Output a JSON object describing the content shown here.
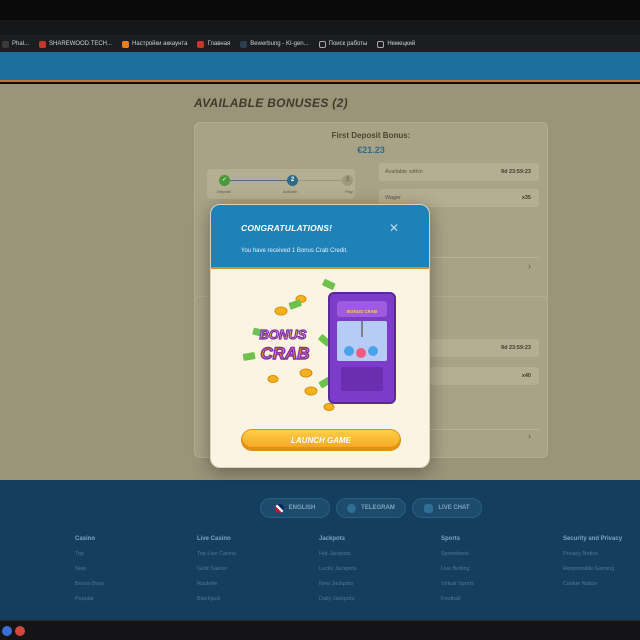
{
  "bookmarks": [
    {
      "label": "Phal...",
      "color": "#3a3a3a"
    },
    {
      "label": "SHAREWOOD.TECH...",
      "color": "#c0392b"
    },
    {
      "label": "Настройки аккаунта",
      "color": "#e67e22"
    },
    {
      "label": "Главная",
      "color": "#c0392b"
    },
    {
      "label": "Bewerbung - KI-gen...",
      "color": "#2c3e50"
    },
    {
      "label": "Поиск работы",
      "color": "#555555"
    },
    {
      "label": "Немецкий",
      "color": "#555555"
    }
  ],
  "page": {
    "title": "AVAILABLE BONUSES (2)",
    "card1": {
      "title": "First Deposit Bonus:",
      "amount": "€21.23",
      "steps": [
        "Deposit",
        "Activate",
        "Play"
      ],
      "step3_num": "3",
      "rows": [
        {
          "key": "Available within",
          "value": "9d 23:59:23"
        },
        {
          "key": "Wager",
          "value": "x35"
        }
      ]
    },
    "card2": {
      "rows": [
        {
          "key": "",
          "value": "9d 23:59:23"
        },
        {
          "key": "",
          "value": "x40"
        }
      ]
    },
    "chevron": "›"
  },
  "modal": {
    "title": "CONGRATULATIONS!",
    "message": "You have received 1 Bonus Crab Credit.",
    "close_glyph": "✕",
    "logo_line1": "BONUS",
    "logo_line2": "CRAB",
    "machine_label": "BONUS CRAB",
    "launch_label": "LAUNCH GAME"
  },
  "footer": {
    "pills": [
      {
        "label": "ENGLISH",
        "icon": "uk-flag-icon"
      },
      {
        "label": "TELEGRAM",
        "icon": "telegram-icon"
      },
      {
        "label": "LIVE CHAT",
        "icon": "chat-icon"
      }
    ],
    "columns": [
      {
        "heading": "Casino",
        "links": [
          "Top",
          "New",
          "Bonus Buys",
          "Popular"
        ]
      },
      {
        "heading": "Live Casino",
        "links": [
          "Top Live Casino",
          "Gold Saloon",
          "Roulette",
          "Blackjack"
        ]
      },
      {
        "heading": "Jackpots",
        "links": [
          "Hot Jackpots",
          "Lucky Jackpots",
          "New Jackpots",
          "Daily Jackpots"
        ]
      },
      {
        "heading": "Sports",
        "links": [
          "Sportsbook",
          "Live Betting",
          "Virtual Sports",
          "Football"
        ]
      },
      {
        "heading": "Security and Privacy",
        "links": [
          "Privacy Notice",
          "Responsible Gaming",
          "Cookie Notice"
        ]
      }
    ]
  },
  "colors": {
    "header_blue": "#1d6f9e",
    "modal_blue": "#1e82b8",
    "launch_orange": "#f4a21c",
    "footer_navy": "#153e5e"
  }
}
